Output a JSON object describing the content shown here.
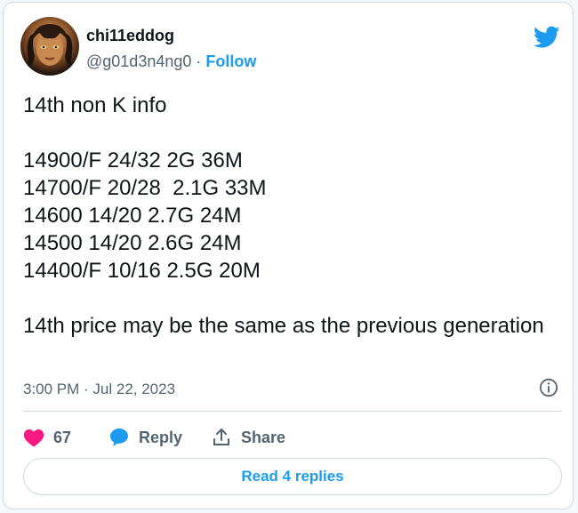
{
  "author": {
    "name": "chi11eddog",
    "handle": "@g01d3n4ng0",
    "separator": " · ",
    "follow_label": "Follow"
  },
  "tweet": {
    "text": "14th non K info\n\n14900/F 24/32 2G 36M\n14700/F 20/28  2.1G 33M\n14600 14/20 2.7G 24M\n14500 14/20 2.6G 24M\n14400/F 10/16 2.5G 20M\n\n14th price may be the same as the previous generation",
    "timestamp": "3:00 PM · Jul 22, 2023"
  },
  "actions": {
    "like_count": "67",
    "reply_label": "Reply",
    "share_label": "Share",
    "read_replies_label": "Read 4 replies"
  },
  "colors": {
    "accent": "#1d9bf0",
    "like": "#f91880",
    "secondary_text": "#536471",
    "primary_text": "#0f1419"
  },
  "icons": [
    "twitter-bird-icon",
    "info-icon",
    "heart-icon",
    "reply-bubble-icon",
    "share-icon"
  ]
}
